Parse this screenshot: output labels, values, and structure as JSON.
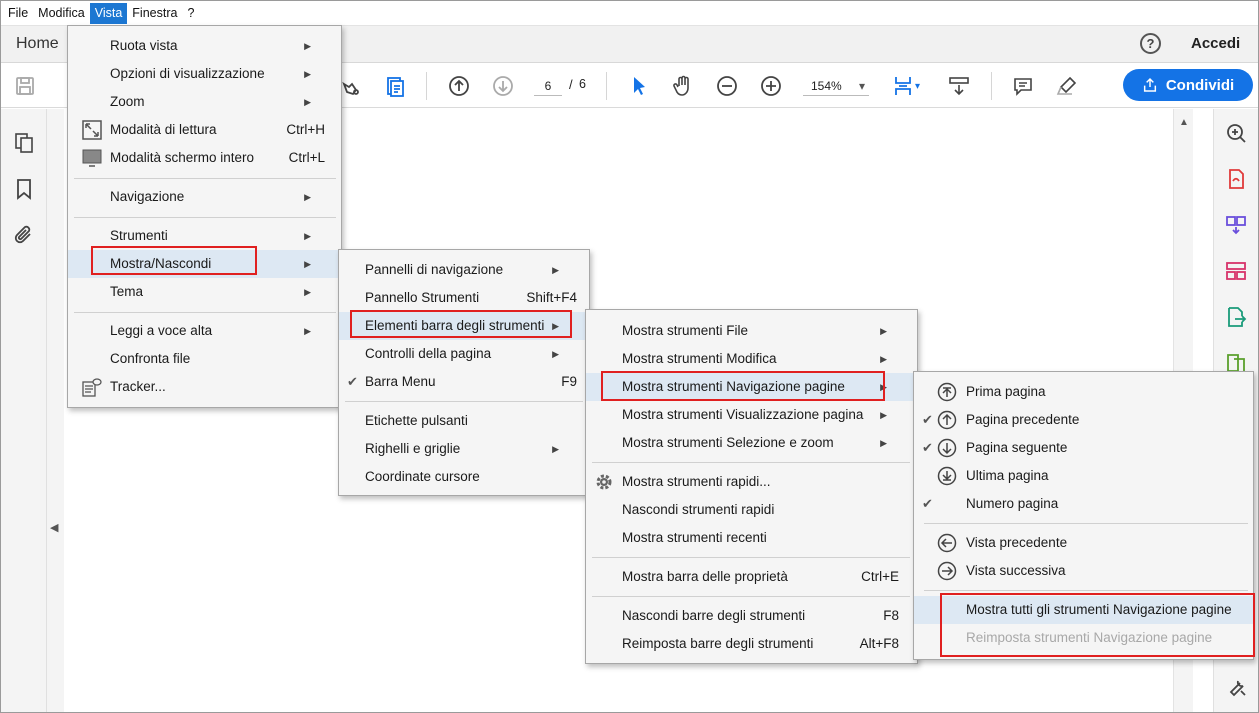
{
  "menubar": {
    "items": [
      "File",
      "Modifica",
      "Vista",
      "Finestra",
      "?"
    ],
    "active": "Vista"
  },
  "tabs": {
    "home": "Home"
  },
  "header": {
    "help": "?",
    "accedi": "Accedi"
  },
  "toolbar": {
    "page_current": "6",
    "page_separator": "/",
    "page_total": "6",
    "zoom": "154%",
    "share_label": "Condividi"
  },
  "menu_vista": {
    "items": [
      {
        "label": "Ruota vista",
        "submenu": true
      },
      {
        "label": "Opzioni di visualizzazione",
        "submenu": true
      },
      {
        "label": "Zoom",
        "submenu": true
      },
      {
        "label": "Modalità di lettura",
        "shortcut": "Ctrl+H"
      },
      {
        "label": "Modalità schermo intero",
        "shortcut": "Ctrl+L"
      },
      {
        "label": "Navigazione",
        "submenu": true
      },
      {
        "label": "Strumenti",
        "submenu": true
      },
      {
        "label": "Mostra/Nascondi",
        "submenu": true,
        "highlighted": true
      },
      {
        "label": "Tema",
        "submenu": true
      },
      {
        "label": "Leggi a voce alta",
        "submenu": true
      },
      {
        "label": "Confronta file"
      },
      {
        "label": "Tracker..."
      }
    ]
  },
  "menu_mostra_nascondi": {
    "items": [
      {
        "label": "Pannelli di navigazione",
        "submenu": true
      },
      {
        "label": "Pannello Strumenti",
        "shortcut": "Shift+F4"
      },
      {
        "label": "Elementi barra degli strumenti",
        "submenu": true,
        "highlighted": true
      },
      {
        "label": "Controlli della pagina",
        "submenu": true
      },
      {
        "label": "Barra Menu",
        "shortcut": "F9",
        "checked": true
      },
      {
        "label": "Etichette pulsanti"
      },
      {
        "label": "Righelli e griglie",
        "submenu": true
      },
      {
        "label": "Coordinate cursore"
      }
    ]
  },
  "menu_elementi": {
    "items": [
      {
        "label": "Mostra strumenti File",
        "submenu": true
      },
      {
        "label": "Mostra strumenti Modifica",
        "submenu": true
      },
      {
        "label": "Mostra strumenti Navigazione pagine",
        "submenu": true,
        "highlighted": true
      },
      {
        "label": "Mostra strumenti Visualizzazione pagina",
        "submenu": true
      },
      {
        "label": "Mostra strumenti Selezione e zoom",
        "submenu": true
      },
      {
        "label": "Mostra strumenti rapidi..."
      },
      {
        "label": "Nascondi strumenti rapidi"
      },
      {
        "label": "Mostra strumenti recenti"
      },
      {
        "label": "Mostra barra delle proprietà",
        "shortcut": "Ctrl+E"
      },
      {
        "label": "Nascondi barre degli strumenti",
        "shortcut": "F8"
      },
      {
        "label": "Reimposta barre degli strumenti",
        "shortcut": "Alt+F8"
      }
    ]
  },
  "menu_navigazione_pagine": {
    "items": [
      {
        "label": "Prima pagina",
        "checked": false
      },
      {
        "label": "Pagina precedente",
        "checked": true
      },
      {
        "label": "Pagina seguente",
        "checked": true
      },
      {
        "label": "Ultima pagina",
        "checked": false
      },
      {
        "label": "Numero pagina",
        "checked": true
      },
      {
        "label": "Vista precedente"
      },
      {
        "label": "Vista successiva"
      },
      {
        "label": "Mostra tutti gli strumenti Navigazione pagine",
        "highlighted": true
      },
      {
        "label": "Reimposta strumenti Navigazione pagine",
        "disabled": true
      }
    ]
  },
  "colors": {
    "accent": "#1473e6",
    "menu_highlight": "#dde8f3",
    "annotation_red": "#e02020"
  }
}
